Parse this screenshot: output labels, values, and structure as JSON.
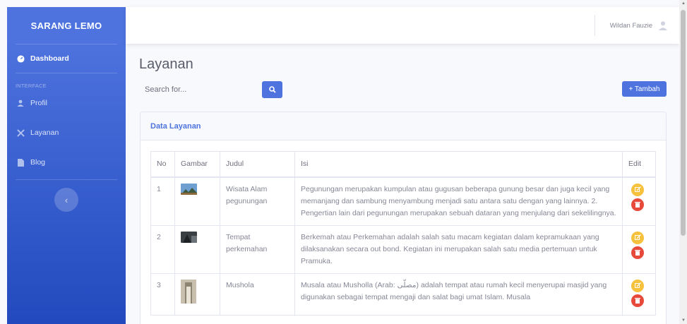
{
  "sidebar": {
    "brand": "SARANG LEMO",
    "dashboard_label": "Dashboard",
    "section_heading": "INTERFACE",
    "items": [
      {
        "label": "Profil",
        "icon": "user-icon"
      },
      {
        "label": "Layanan",
        "icon": "tools-icon"
      },
      {
        "label": "Blog",
        "icon": "file-icon"
      }
    ],
    "toggle_icon": "chevron-left-icon"
  },
  "topbar": {
    "user_name": "Wildan Fauzie",
    "avatar_icon": "user-avatar-icon"
  },
  "page": {
    "title": "Layanan",
    "search_placeholder": "Search for...",
    "add_label": "+ Tambah"
  },
  "card": {
    "title": "Data Layanan",
    "columns": [
      "No",
      "Gambar",
      "Judul",
      "Isi",
      "Edit"
    ],
    "rows": [
      {
        "no": "1",
        "judul": "Wisata Alam pegunungan",
        "isi": "Pegunungan merupakan kumpulan atau gugusan beberapa gunung besar dan juga kecil yang memanjang dan sambung menyambung menjadi satu antara satu dengan yang lainnya. 2. Pengertian lain dari pegunungan merupakan sebuah dataran yang menjulang dari sekelilingnya."
      },
      {
        "no": "2",
        "judul": "Tempat perkemahan",
        "isi": "Berkemah atau Perkemahan adalah salah satu macam kegiatan dalam kepramukaan yang dilaksanakan secara out bond. Kegiatan ini merupakan salah satu media pertemuan untuk Pramuka."
      },
      {
        "no": "3",
        "judul": "Mushola",
        "isi": "Musala atau Musholla (Arab: مصلّى) adalah tempat atau rumah kecil menyerupai masjid yang digunakan sebagai tempat mengaji dan salat bagi umat Islam. Musala"
      }
    ]
  },
  "colors": {
    "primary": "#4e73df",
    "warning": "#f6c23e",
    "danger": "#e74a3b"
  }
}
